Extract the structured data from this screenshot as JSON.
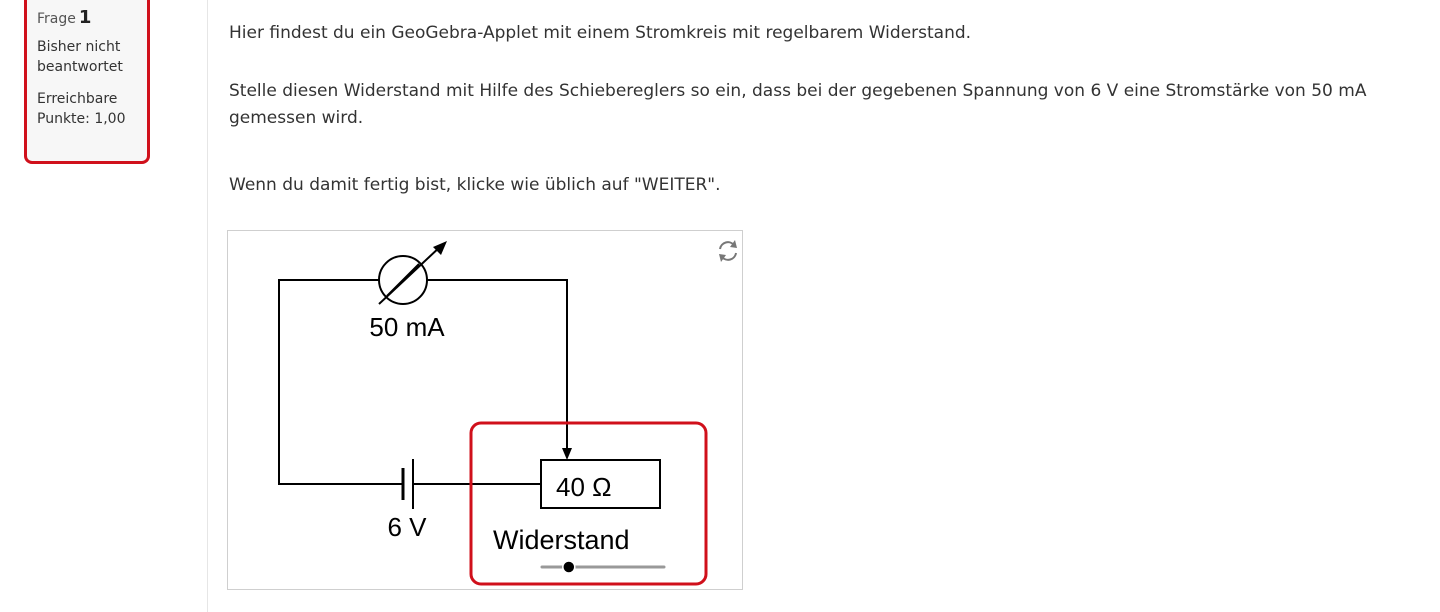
{
  "question_info": {
    "label": "Frage",
    "number": "1",
    "state_line1": "Bisher nicht",
    "state_line2": "beantwortet",
    "points_line1": "Erreichbare",
    "points_line2": "Punkte: 1,00"
  },
  "question_text": {
    "paragraph1": "Hier findest du ein GeoGebra-Applet mit einem Stromkreis mit regelbarem Widerstand.",
    "paragraph2": "Stelle diesen Widerstand mit Hilfe des Schiebereglers so ein, dass bei der gegebenen Spannung von 6 V eine Stromstärke von 50 mA gemessen wird.",
    "paragraph3": "Wenn du damit fertig bist, klicke wie üblich auf \"WEITER\"."
  },
  "applet": {
    "current_label": "50 mA",
    "voltage_label": "6 V",
    "resistance_label": "40 Ω",
    "slider_label": "Widerstand",
    "slider_value_fraction": 0.22,
    "reset_icon": "refresh-icon",
    "colors": {
      "highlight": "#d0101b",
      "wire": "#000000",
      "slider_track": "#999999"
    }
  }
}
